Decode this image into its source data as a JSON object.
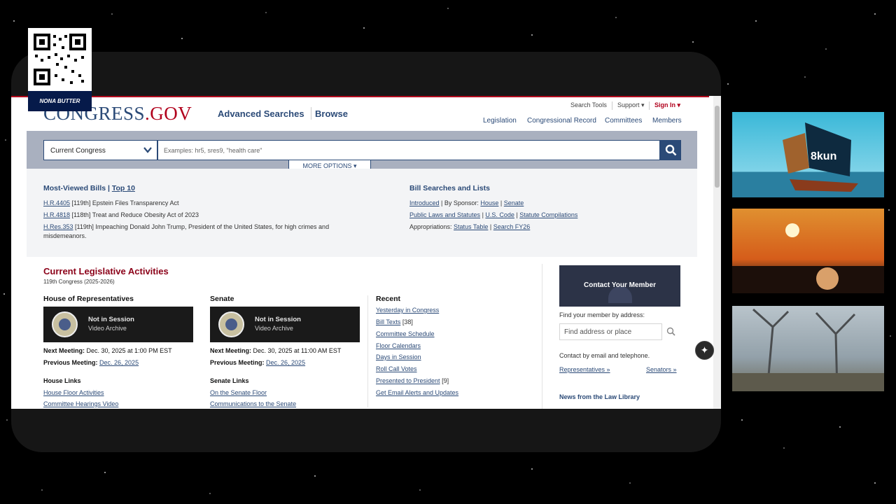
{
  "overlay": {
    "qr_label": "NONA BUTTER",
    "tile_1_logo": "8kun"
  },
  "header": {
    "logo_main": "CONGRESS",
    "logo_tld": ".GOV",
    "nav": [
      "Advanced Searches",
      "Browse"
    ],
    "utility": [
      "Search Tools",
      "Support ▾",
      "Sign In ▾"
    ],
    "subnav": [
      "Legislation",
      "Congressional Record",
      "Committees",
      "Members"
    ]
  },
  "search": {
    "congress_select": "Current Congress",
    "placeholder": "Examples: hr5, sres9, \"health care\"",
    "more_options": "MORE OPTIONS ▾"
  },
  "most_viewed": {
    "title": "Most-Viewed Bills |",
    "top10": "Top 10",
    "bills": [
      {
        "id": "H.R.4405",
        "text": " [119th] Epstein Files Transparency Act"
      },
      {
        "id": "H.R.4818",
        "text": " [118th] Treat and Reduce Obesity Act of 2023"
      },
      {
        "id": "H.Res.353",
        "text": " [119th] Impeaching Donald John Trump, President of the United States, for high crimes and"
      },
      {
        "id": "",
        "text": "misdemeanors."
      }
    ]
  },
  "bill_searches": {
    "title": "Bill Searches and Lists",
    "row1": {
      "a": "Introduced",
      "sep": " | By Sponsor: ",
      "b": "House",
      "c": "Senate"
    },
    "row2": {
      "a": "Public Laws and Statutes",
      "b": "U.S. Code",
      "c": "Statute Compilations"
    },
    "row3": {
      "label": "Appropriations: ",
      "a": "Status Table",
      "b": "Search FY26"
    }
  },
  "activities": {
    "title": "Current Legislative Activities",
    "subtitle": "119th Congress (2025-2026)",
    "house": {
      "heading": "House of Representatives",
      "status": "Not in Session",
      "archive": "Video Archive",
      "next_label": "Next Meeting:",
      "next_value": " Dec. 30, 2025 at 1:00 PM EST",
      "prev_label": "Previous Meeting:",
      "prev_value": "Dec. 26, 2025",
      "links_heading": "House Links",
      "links": [
        "House Floor Activities",
        "Committee Hearings Video"
      ]
    },
    "senate": {
      "heading": "Senate",
      "status": "Not in Session",
      "archive": "Video Archive",
      "next_label": "Next Meeting:",
      "next_value": " Dec. 30, 2025 at 11:00 AM EST",
      "prev_label": "Previous Meeting:",
      "prev_value": "Dec. 26, 2025",
      "links_heading": "Senate Links",
      "links": [
        "On the Senate Floor",
        "Communications to the Senate"
      ]
    },
    "recent": {
      "heading": "Recent",
      "links": [
        {
          "label": "Yesterday in Congress",
          "count": ""
        },
        {
          "label": "Bill Texts",
          "count": " [38]"
        },
        {
          "label": "Committee Schedule",
          "count": ""
        },
        {
          "label": "Floor Calendars",
          "count": ""
        },
        {
          "label": "Days in Session",
          "count": ""
        },
        {
          "label": "Roll Call Votes",
          "count": ""
        },
        {
          "label": "Presented to President",
          "count": " [9]"
        },
        {
          "label": "Get Email Alerts and Updates",
          "count": ""
        }
      ]
    }
  },
  "sidebar": {
    "contact_title": "Contact Your Member",
    "find_label": "Find your member by address:",
    "address_placeholder": "Find address or place",
    "contact_text": "Contact by email and telephone.",
    "representatives": "Representatives »",
    "senators": "Senators »",
    "news": "News from the Law Library"
  },
  "colors": {
    "brand_blue": "#2b4a77",
    "brand_red": "#b1001c"
  }
}
